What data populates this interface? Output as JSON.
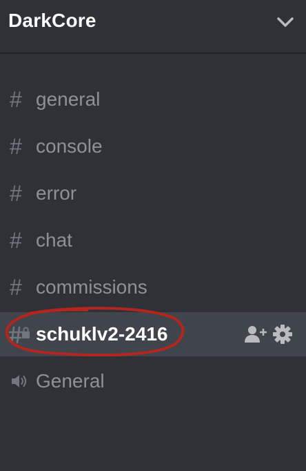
{
  "server": {
    "name": "DarkCore",
    "menu_icon": "chevron-down-icon"
  },
  "text_channels": [
    {
      "name": "general",
      "icon": "hash-icon"
    },
    {
      "name": "console",
      "icon": "hash-icon"
    },
    {
      "name": "error",
      "icon": "hash-icon"
    },
    {
      "name": "chat",
      "icon": "hash-icon"
    },
    {
      "name": "commissions",
      "icon": "hash-icon"
    }
  ],
  "selected_channel": {
    "name": "schuklv2-2416",
    "icon": "locked-hash-icon",
    "actions": [
      "invite-member-icon",
      "settings-gear-icon"
    ]
  },
  "voice_channels": [
    {
      "name": "General",
      "icon": "speaker-icon"
    }
  ],
  "colors": {
    "background": "#2f3136",
    "selected_row": "#40444b",
    "muted_text": "#8e9297",
    "icon_gray": "#72767d",
    "annotation_red": "#b3261e"
  }
}
